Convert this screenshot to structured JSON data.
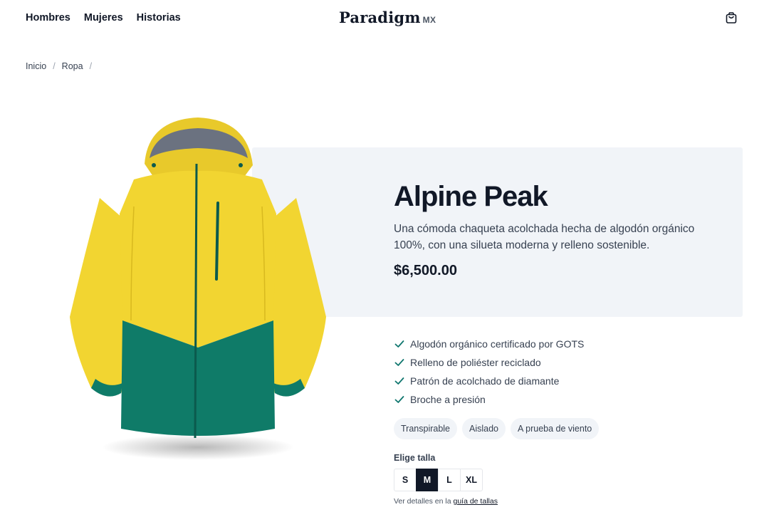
{
  "nav": {
    "items": [
      "Hombres",
      "Mujeres",
      "Historias"
    ]
  },
  "brand": {
    "name": "Paradigm",
    "suffix": "MX"
  },
  "breadcrumb": {
    "items": [
      "Inicio",
      "Ropa"
    ],
    "separator": "/"
  },
  "product": {
    "title": "Alpine Peak",
    "description": "Una cómoda chaqueta acolchada hecha de algodón orgánico 100%, con una silueta moderna y relleno sostenible.",
    "price": "$6,500.00",
    "features": [
      "Algodón orgánico certificado por GOTS",
      "Relleno de poliéster reciclado",
      "Patrón de acolchado de diamante",
      "Broche a presión"
    ],
    "tags": [
      "Transpirable",
      "Aislado",
      "A prueba de viento"
    ],
    "size_label": "Elige talla",
    "sizes": [
      "S",
      "M",
      "L",
      "XL"
    ],
    "selected_size": "M",
    "size_note_prefix": "Ver detalles en la",
    "size_guide_link": "guía de tallas"
  },
  "colors": {
    "accent": "#111827",
    "panel_bg": "#f1f4f8",
    "check": "#0f766e",
    "jacket_yellow": "#f2d531",
    "jacket_green": "#0f7b68"
  },
  "icons": {
    "cart": "shopping-bag-icon",
    "check": "check-icon"
  }
}
